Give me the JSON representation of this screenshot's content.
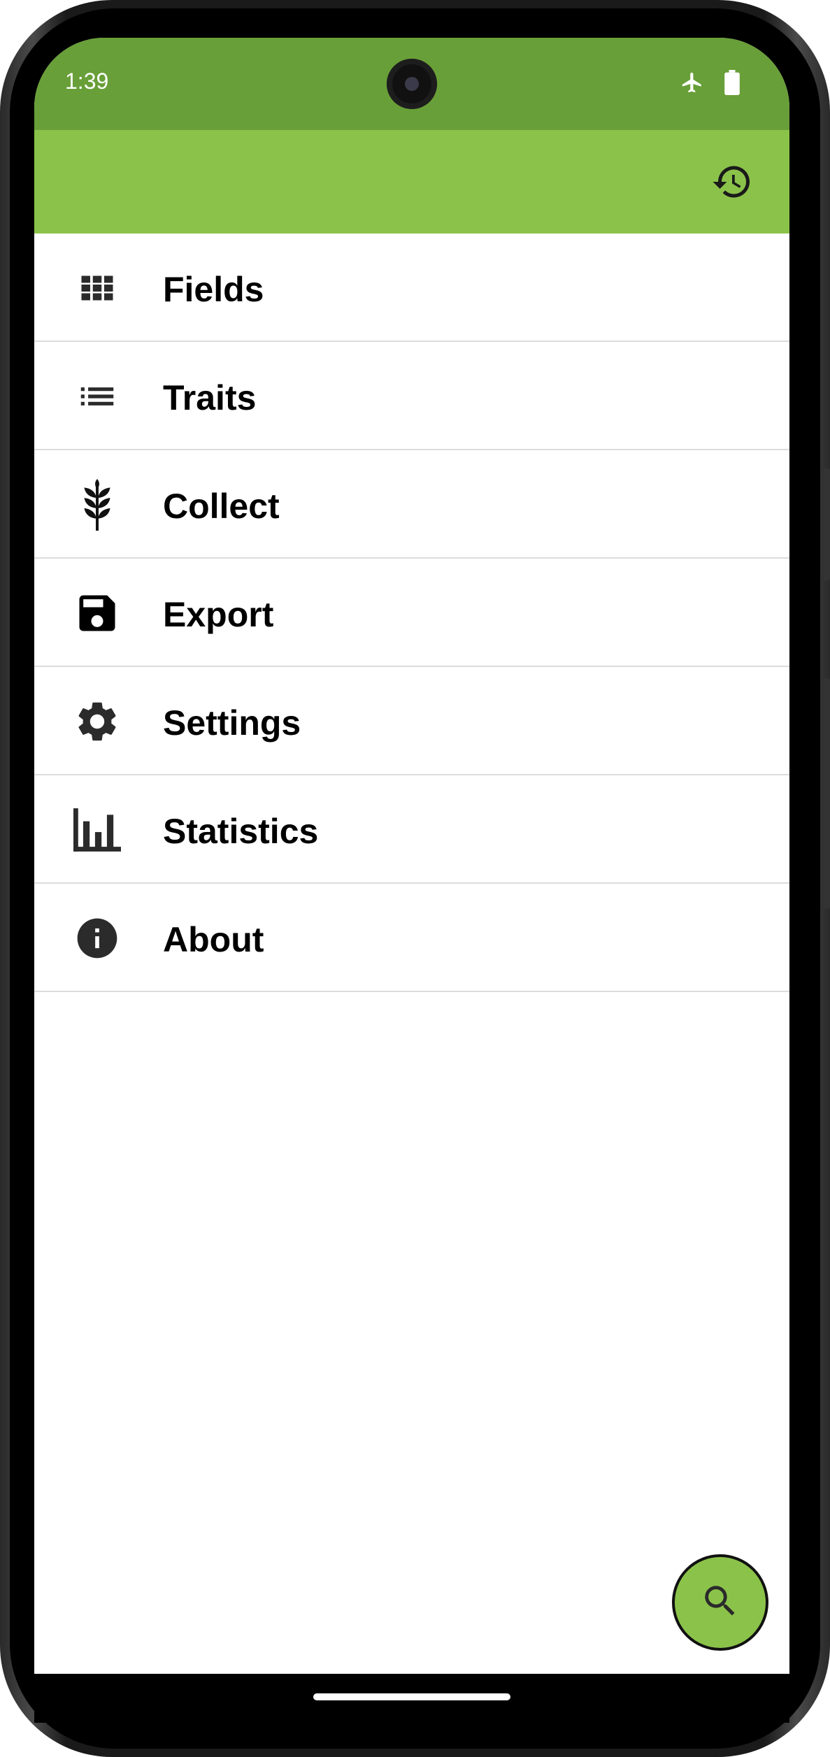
{
  "status_bar": {
    "time": "1:39",
    "icons": [
      "airplane-icon",
      "battery-icon"
    ],
    "color": "#689f38"
  },
  "toolbar": {
    "color": "#8bc34a",
    "action_icon": "history-icon"
  },
  "menu": {
    "items": [
      {
        "label": "Fields",
        "icon": "grid-icon"
      },
      {
        "label": "Traits",
        "icon": "list-icon"
      },
      {
        "label": "Collect",
        "icon": "wheat-icon"
      },
      {
        "label": "Export",
        "icon": "save-icon"
      },
      {
        "label": "Settings",
        "icon": "gear-icon"
      },
      {
        "label": "Statistics",
        "icon": "bar-chart-icon"
      },
      {
        "label": "About",
        "icon": "info-icon"
      }
    ]
  },
  "fab": {
    "icon": "search-icon",
    "color": "#8bc34a"
  }
}
